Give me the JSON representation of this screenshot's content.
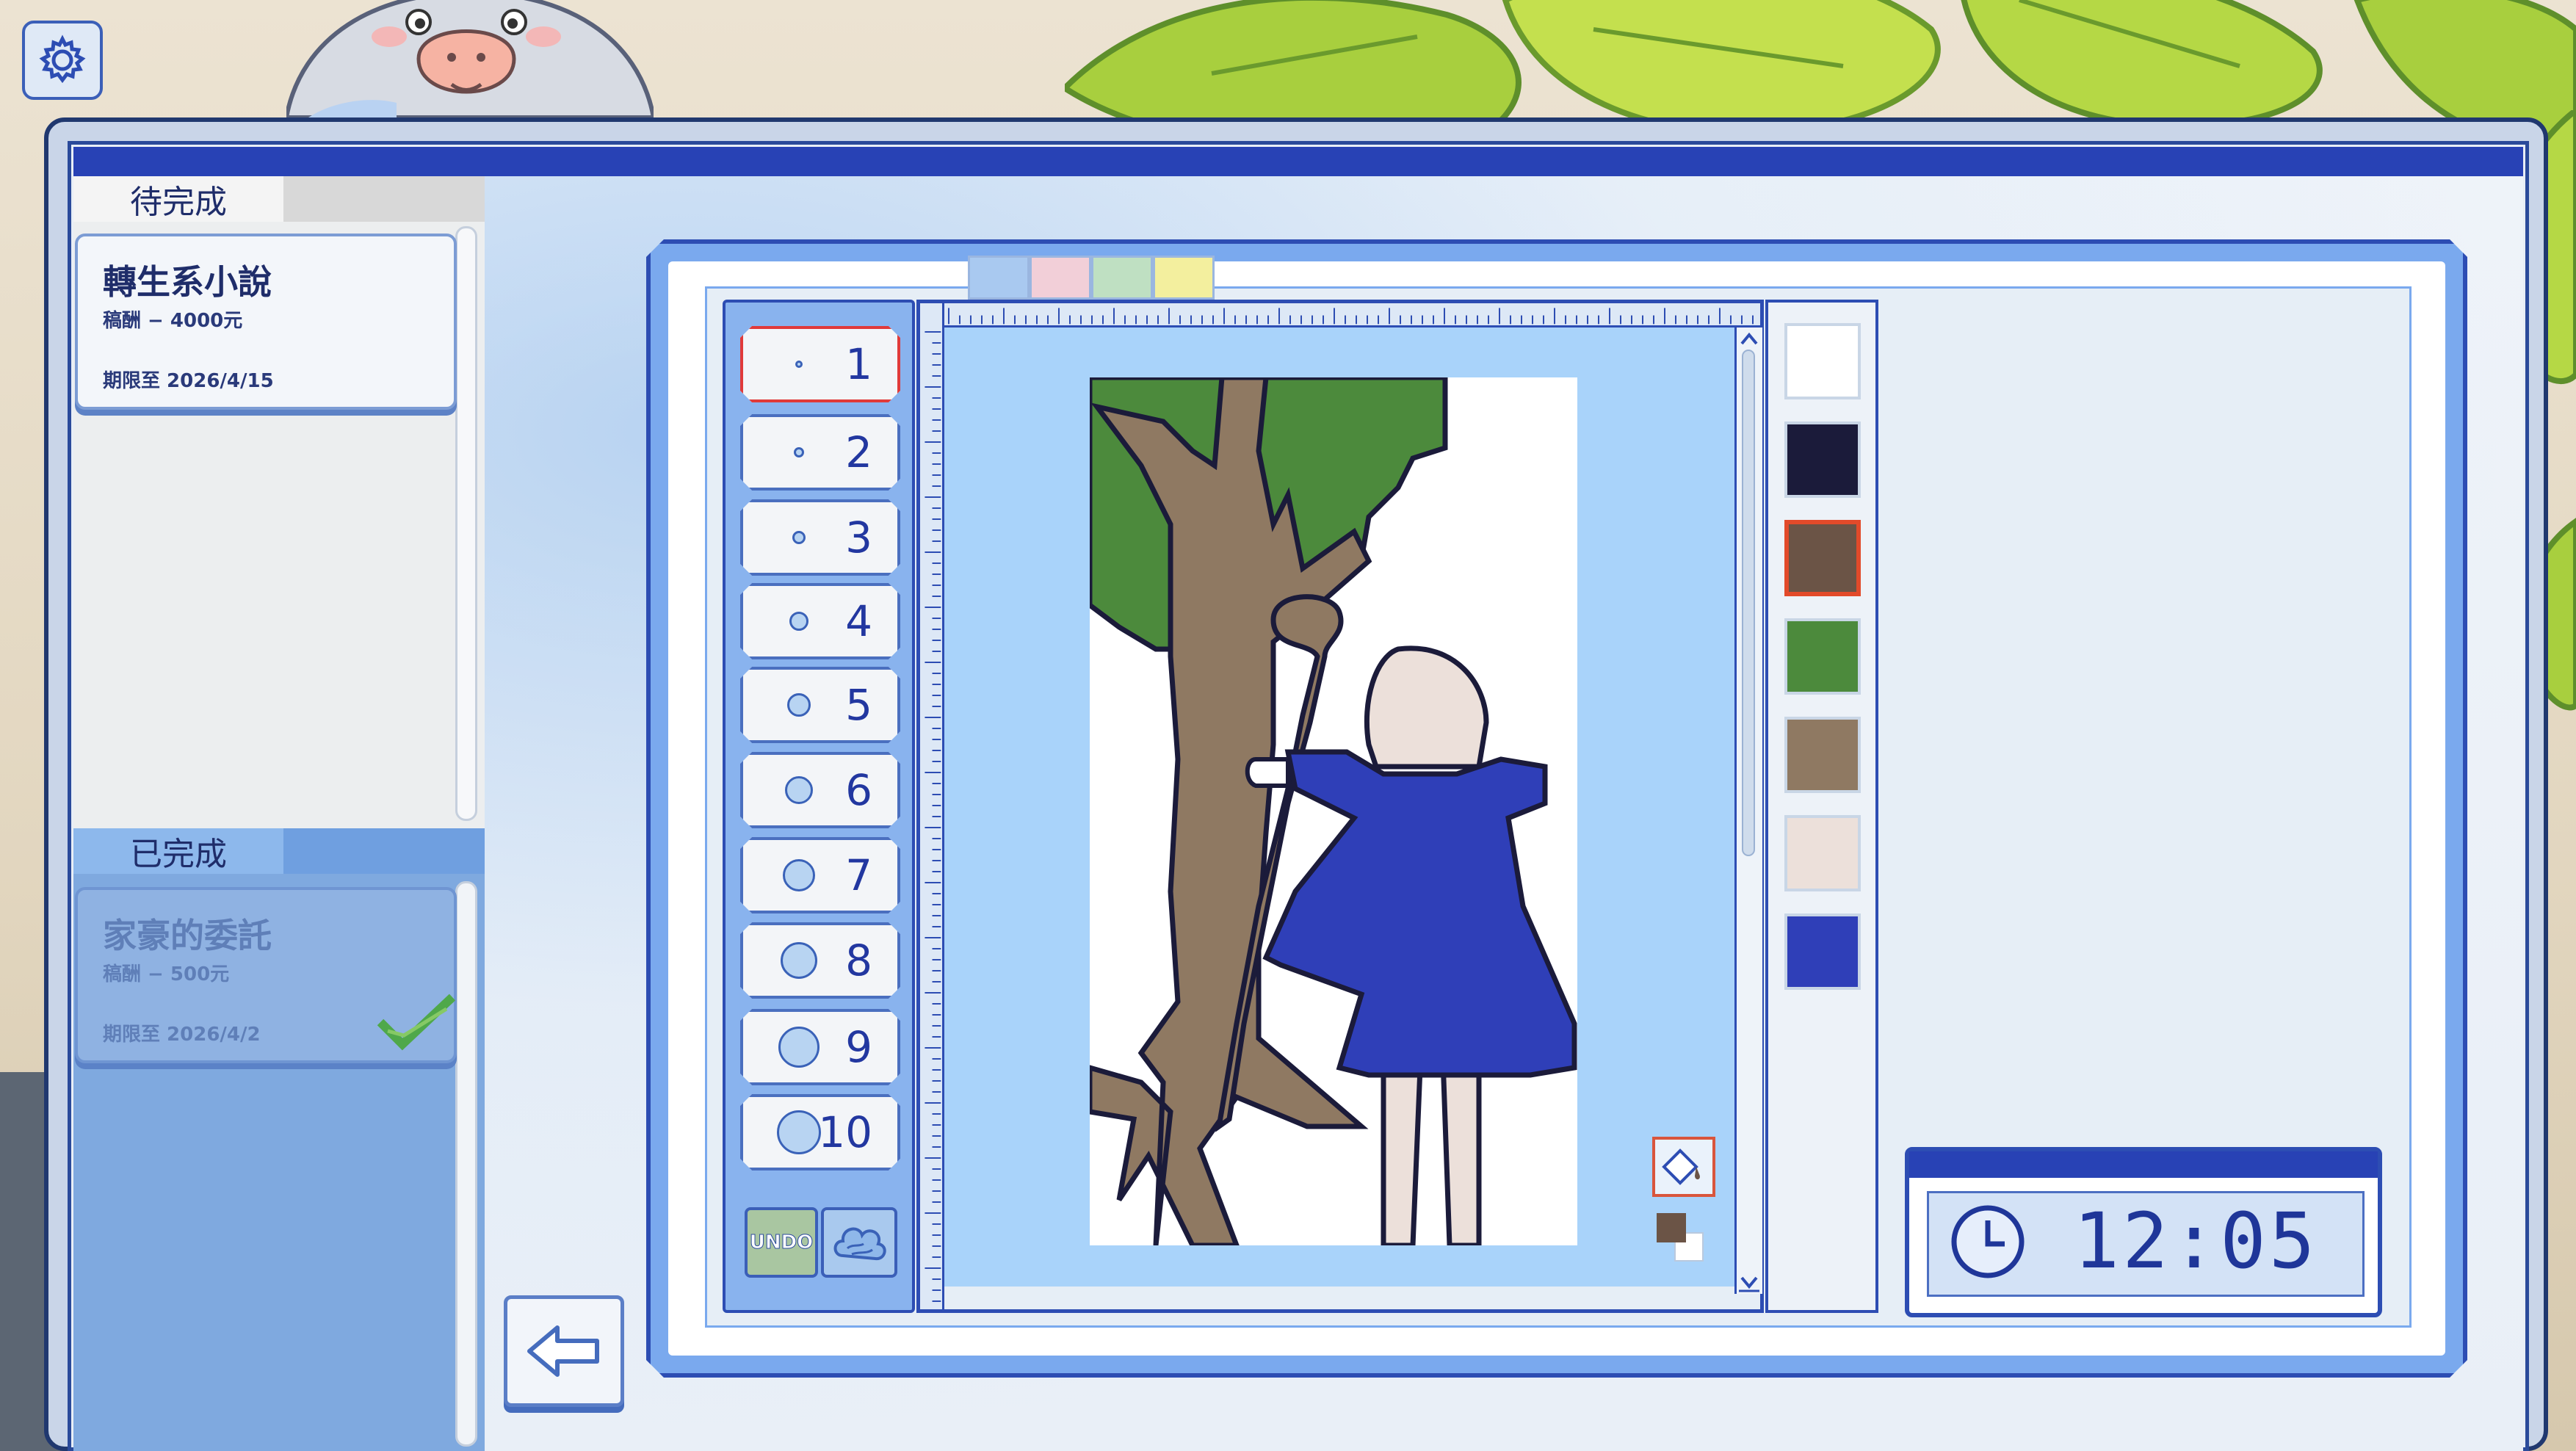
{
  "settings": {
    "icon": "gear-icon"
  },
  "tasks": {
    "pending_label": "待完成",
    "completed_label": "已完成",
    "pending": [
      {
        "title": "轉生系小說",
        "fee": "稿酬 − 4000元",
        "due": "期限至 2026/4/15"
      }
    ],
    "completed": [
      {
        "title": "家豪的委託",
        "fee": "稿酬 − 500元",
        "due": "期限至 2026/4/2",
        "status_icon": "check-icon"
      }
    ]
  },
  "canvas_tabs": [
    "#a9c9f0",
    "#f2cfd8",
    "#bfe0c2",
    "#f3ef9e"
  ],
  "brush_sizes": {
    "selected": 1,
    "items": [
      {
        "label": "1"
      },
      {
        "label": "2"
      },
      {
        "label": "3"
      },
      {
        "label": "4"
      },
      {
        "label": "5"
      },
      {
        "label": "6"
      },
      {
        "label": "7"
      },
      {
        "label": "8"
      },
      {
        "label": "9"
      },
      {
        "label": "10"
      }
    ]
  },
  "tools": {
    "undo_label": "UNDO",
    "texture_icon": "cloud-texture-icon",
    "fill_icon": "paint-bucket-icon"
  },
  "palette": {
    "selected_index": 2,
    "colors": [
      "#ffffff",
      "#1b1b3a",
      "#6b5446",
      "#4c8a3c",
      "#8f7962",
      "#ece0da",
      "#2f3fb8"
    ]
  },
  "current_colors": {
    "foreground": "#6b5446",
    "background": "#ffffff"
  },
  "clock": {
    "time": "12:05",
    "icon": "clock-icon"
  },
  "navigation": {
    "back_icon": "arrow-left-icon"
  }
}
